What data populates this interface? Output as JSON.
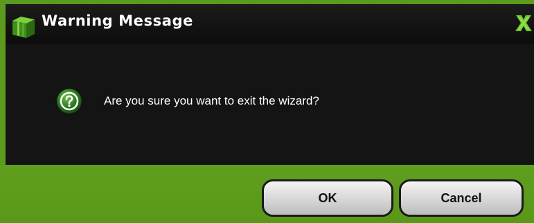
{
  "dialog": {
    "title": "Warning Message",
    "title_icon": "cube-icon",
    "close_icon": "close-x-icon",
    "message": "Are you sure you want to exit the wizard?",
    "message_icon": "question-icon",
    "buttons": {
      "ok_label": "OK",
      "cancel_label": "Cancel"
    },
    "colors": {
      "frame_green": "#5b9a1c",
      "panel_dark": "#141414",
      "titlebar_dark": "#111111",
      "text_white": "#ffffff",
      "accent_green": "#4caf1a"
    }
  }
}
